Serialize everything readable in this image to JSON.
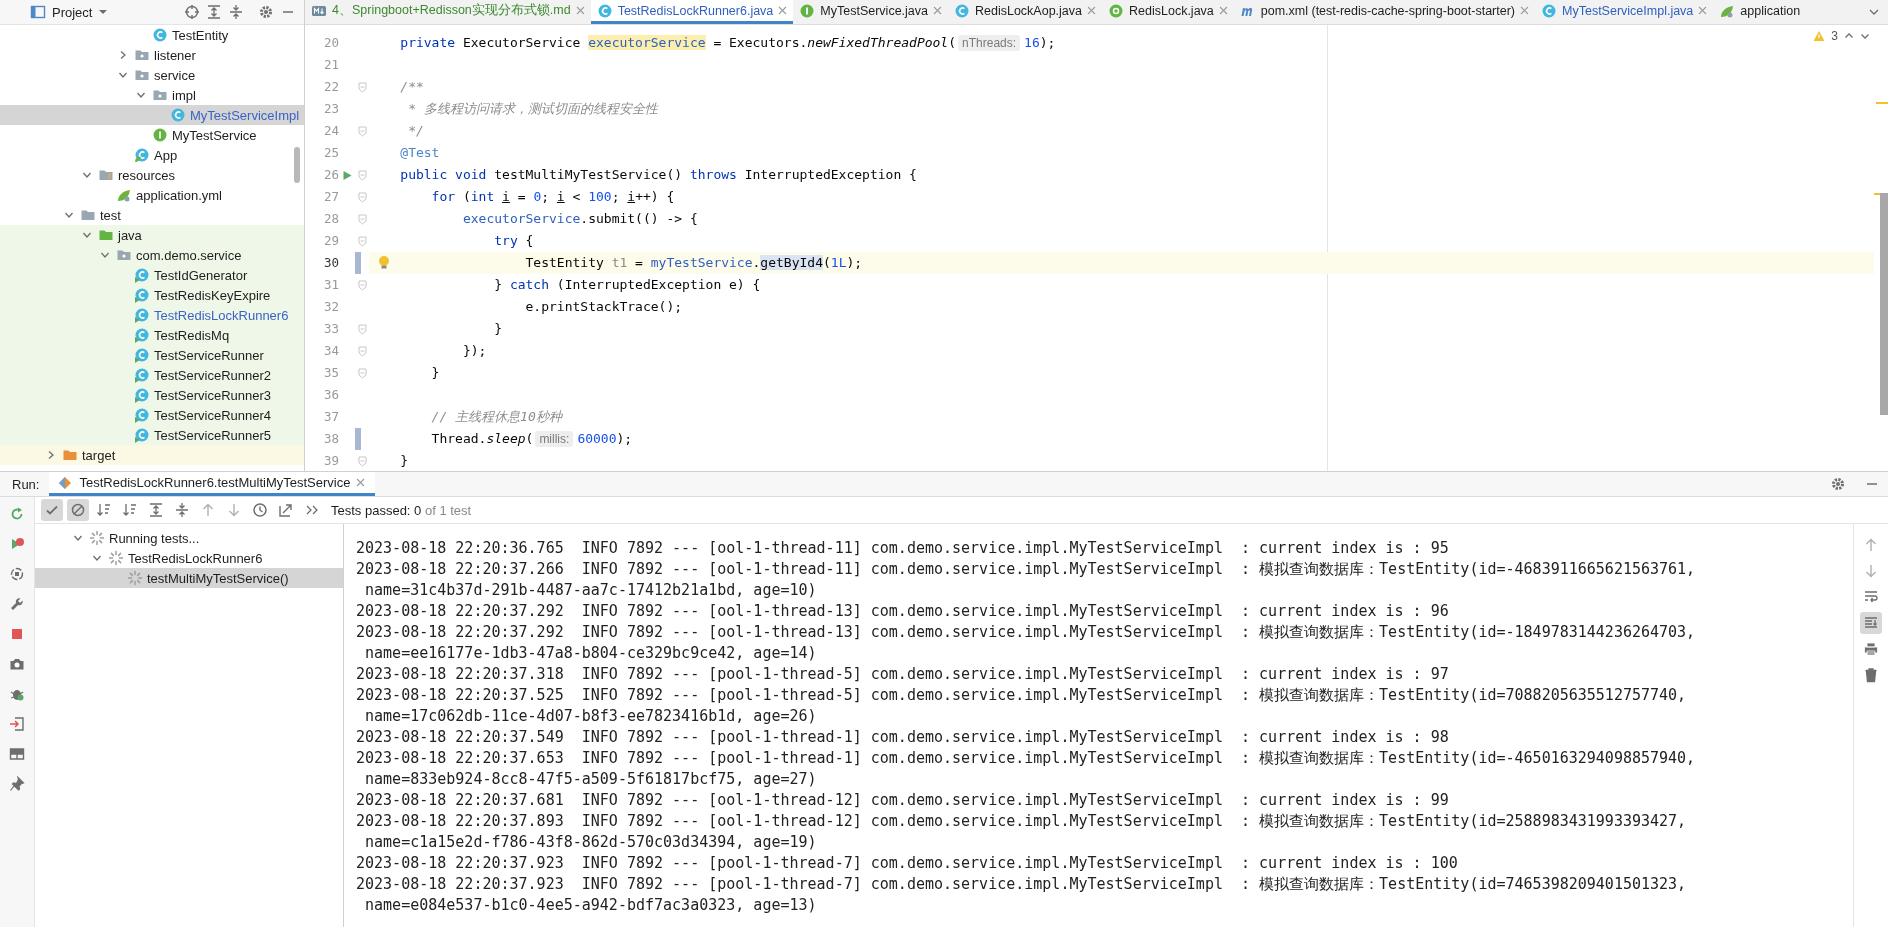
{
  "project_panel": {
    "title": "Project",
    "tree": [
      {
        "children": [
          {
            "children": [
              {
                "children": [
                  {
                    "children": [
                      {
                        "children": [
                          {
                            "label": "TestEntity",
                            "kind": "class",
                            "selected": false,
                            "modified": false,
                            "test_scope": false,
                            "excluded": false
                          }
                        ]
                      },
                      {
                        "label": "listener",
                        "kind": "package",
                        "expanded": false,
                        "selected": false,
                        "modified": false,
                        "test_scope": false,
                        "excluded": false
                      },
                      {
                        "label": "service",
                        "kind": "package",
                        "expanded": true,
                        "selected": false,
                        "modified": false,
                        "test_scope": false,
                        "excluded": false,
                        "children": [
                          {
                            "label": "impl",
                            "kind": "package",
                            "expanded": true,
                            "selected": false,
                            "modified": false,
                            "test_scope": false,
                            "excluded": false,
                            "children": [
                              {
                                "label": "MyTestServiceImpl",
                                "kind": "class",
                                "selected": true,
                                "modified": true,
                                "test_scope": false,
                                "excluded": false
                              }
                            ]
                          },
                          {
                            "label": "MyTestService",
                            "kind": "interface",
                            "selected": false,
                            "modified": false,
                            "test_scope": false,
                            "excluded": false
                          }
                        ]
                      },
                      {
                        "label": "App",
                        "kind": "boot",
                        "selected": false,
                        "modified": false,
                        "test_scope": false,
                        "excluded": false
                      }
                    ]
                  }
                ]
              },
              {
                "label": "resources",
                "kind": "resources",
                "expanded": true,
                "selected": false,
                "modified": false,
                "test_scope": false,
                "excluded": false,
                "children": [
                  {
                    "label": "application.yml",
                    "kind": "yml",
                    "selected": false,
                    "modified": false,
                    "test_scope": false,
                    "excluded": false
                  }
                ]
              }
            ]
          },
          {
            "label": "test",
            "kind": "folder",
            "expanded": true,
            "selected": false,
            "modified": false,
            "test_scope": false,
            "excluded": false,
            "children": [
              {
                "label": "java",
                "kind": "test-source",
                "expanded": true,
                "selected": false,
                "modified": false,
                "test_scope": true,
                "excluded": false,
                "children": [
                  {
                    "label": "com.demo.service",
                    "kind": "package",
                    "expanded": true,
                    "selected": false,
                    "modified": false,
                    "test_scope": true,
                    "excluded": false,
                    "children": [
                      {
                        "label": "TestIdGenerator",
                        "kind": "test-class",
                        "selected": false,
                        "modified": false,
                        "test_scope": true,
                        "excluded": false
                      },
                      {
                        "label": "TestRedisKeyExpire",
                        "kind": "test-class",
                        "selected": false,
                        "modified": false,
                        "test_scope": true,
                        "excluded": false
                      },
                      {
                        "label": "TestRedisLockRunner6",
                        "kind": "test-class",
                        "selected": false,
                        "modified": true,
                        "test_scope": true,
                        "excluded": false
                      },
                      {
                        "label": "TestRedisMq",
                        "kind": "test-class",
                        "selected": false,
                        "modified": false,
                        "test_scope": true,
                        "excluded": false
                      },
                      {
                        "label": "TestServiceRunner",
                        "kind": "test-class",
                        "selected": false,
                        "modified": false,
                        "test_scope": true,
                        "excluded": false
                      },
                      {
                        "label": "TestServiceRunner2",
                        "kind": "test-class",
                        "selected": false,
                        "modified": false,
                        "test_scope": true,
                        "excluded": false
                      },
                      {
                        "label": "TestServiceRunner3",
                        "kind": "test-class",
                        "selected": false,
                        "modified": false,
                        "test_scope": true,
                        "excluded": false
                      },
                      {
                        "label": "TestServiceRunner4",
                        "kind": "test-class",
                        "selected": false,
                        "modified": false,
                        "test_scope": true,
                        "excluded": false
                      },
                      {
                        "label": "TestServiceRunner5",
                        "kind": "test-class",
                        "selected": false,
                        "modified": false,
                        "test_scope": true,
                        "excluded": false
                      }
                    ]
                  }
                ]
              }
            ]
          }
        ]
      },
      {
        "label": "target",
        "kind": "excluded",
        "expanded": false,
        "selected": false,
        "modified": false,
        "test_scope": false,
        "excluded": true
      }
    ]
  },
  "editor_tabs": [
    {
      "label": "4、Springboot+Redisson实现分布式锁.md",
      "kind": "md",
      "color": "#3c8a2e",
      "selected": false,
      "closable": true
    },
    {
      "label": "TestRedisLockRunner6.java",
      "kind": "class",
      "color": "#2f5fbf",
      "selected": true,
      "closable": true
    },
    {
      "label": "MyTestService.java",
      "kind": "interface",
      "color": "#1e1e1e",
      "selected": false,
      "closable": true
    },
    {
      "label": "RedisLockAop.java",
      "kind": "class",
      "color": "#1e1e1e",
      "selected": false,
      "closable": true
    },
    {
      "label": "RedisLock.java",
      "kind": "annotation",
      "color": "#1e1e1e",
      "selected": false,
      "closable": true
    },
    {
      "label": "pom.xml (test-redis-cache-spring-boot-starter)",
      "kind": "maven",
      "color": "#1e1e1e",
      "selected": false,
      "closable": true
    },
    {
      "label": "MyTestServiceImpl.java",
      "kind": "class",
      "color": "#2f5fbf",
      "selected": false,
      "closable": true
    },
    {
      "label": "application",
      "kind": "yml",
      "color": "#1e1e1e",
      "selected": false,
      "closable": false
    }
  ],
  "editor": {
    "warnings": "3",
    "lines": [
      {
        "num": "20",
        "runnable": false,
        "intention": false,
        "fold": false,
        "changed": false,
        "current": false,
        "tokens": [
          {
            "kind": "kw",
            "text": "    private"
          },
          {
            "kind": "plain",
            "text": " ExecutorService "
          },
          {
            "kind": "decl",
            "text": "executorService"
          },
          {
            "kind": "plain",
            "text": " = Executors."
          },
          {
            "kind": "italic",
            "text": "newFixedThreadPool"
          },
          {
            "kind": "plain",
            "text": "("
          },
          {
            "kind": "hint",
            "text": "nThreads:"
          },
          {
            "kind": "num",
            "text": "16"
          },
          {
            "kind": "plain",
            "text": ");"
          }
        ]
      },
      {
        "num": "21",
        "runnable": false,
        "intention": false,
        "fold": false,
        "changed": false,
        "current": false
      },
      {
        "num": "22",
        "runnable": false,
        "intention": false,
        "fold": true,
        "changed": false,
        "current": false,
        "tokens": [
          {
            "kind": "comment",
            "text": "    /**"
          }
        ]
      },
      {
        "num": "23",
        "runnable": false,
        "intention": false,
        "fold": false,
        "changed": false,
        "current": false,
        "tokens": [
          {
            "kind": "comment",
            "text": "     * 多线程访问请求，测试切面的线程安全性"
          }
        ]
      },
      {
        "num": "24",
        "runnable": false,
        "intention": false,
        "fold": true,
        "changed": false,
        "current": false,
        "tokens": [
          {
            "kind": "comment",
            "text": "     */"
          }
        ]
      },
      {
        "num": "25",
        "runnable": false,
        "intention": false,
        "fold": false,
        "changed": false,
        "current": false,
        "tokens": [
          {
            "kind": "annotation",
            "text": "    @Test"
          }
        ]
      },
      {
        "num": "26",
        "runnable": true,
        "intention": false,
        "fold": true,
        "changed": false,
        "current": false,
        "tokens": [
          {
            "kind": "kw",
            "text": "    public void"
          },
          {
            "kind": "plain",
            "text": " testMultiMyTestService() "
          },
          {
            "kind": "kw",
            "text": "throws"
          },
          {
            "kind": "plain",
            "text": " InterruptedException {"
          }
        ]
      },
      {
        "num": "27",
        "runnable": false,
        "intention": false,
        "fold": true,
        "changed": false,
        "current": false,
        "tokens": [
          {
            "kind": "kw",
            "text": "        for"
          },
          {
            "kind": "plain",
            "text": " ("
          },
          {
            "kind": "kw",
            "text": "int "
          },
          {
            "kind": "var",
            "text": "i"
          },
          {
            "kind": "plain",
            "text": " = "
          },
          {
            "kind": "num",
            "text": "0"
          },
          {
            "kind": "plain",
            "text": "; "
          },
          {
            "kind": "var",
            "text": "i"
          },
          {
            "kind": "plain",
            "text": " < "
          },
          {
            "kind": "num",
            "text": "100"
          },
          {
            "kind": "plain",
            "text": "; "
          },
          {
            "kind": "var",
            "text": "i"
          },
          {
            "kind": "plain",
            "text": "++) {"
          }
        ]
      },
      {
        "num": "28",
        "runnable": false,
        "intention": false,
        "fold": true,
        "changed": false,
        "current": false,
        "tokens": [
          {
            "kind": "field",
            "text": "            executorService"
          },
          {
            "kind": "plain",
            "text": ".submit(() -> {"
          }
        ]
      },
      {
        "num": "29",
        "runnable": false,
        "intention": false,
        "fold": true,
        "changed": false,
        "current": false,
        "tokens": [
          {
            "kind": "kw",
            "text": "                try"
          },
          {
            "kind": "plain",
            "text": " {"
          }
        ]
      },
      {
        "num": "30",
        "runnable": false,
        "intention": true,
        "fold": false,
        "changed": true,
        "current": true,
        "tokens": [
          {
            "kind": "plain",
            "text": "                    TestEntity "
          },
          {
            "kind": "unused",
            "text": "t1"
          },
          {
            "kind": "plain",
            "text": " = "
          },
          {
            "kind": "field",
            "text": "myTestService"
          },
          {
            "kind": "plain",
            "text": "."
          },
          {
            "kind": "usage",
            "text": "getById4"
          },
          {
            "kind": "plain",
            "text": "("
          },
          {
            "kind": "num",
            "text": "1L"
          },
          {
            "kind": "plain",
            "text": ");"
          }
        ]
      },
      {
        "num": "31",
        "runnable": false,
        "intention": false,
        "fold": true,
        "changed": false,
        "current": false,
        "tokens": [
          {
            "kind": "plain",
            "text": "                } "
          },
          {
            "kind": "kw",
            "text": "catch"
          },
          {
            "kind": "plain",
            "text": " (InterruptedException e) {"
          }
        ]
      },
      {
        "num": "32",
        "runnable": false,
        "intention": false,
        "fold": false,
        "changed": false,
        "current": false,
        "tokens": [
          {
            "kind": "plain",
            "text": "                    e.printStackTrace();"
          }
        ]
      },
      {
        "num": "33",
        "runnable": false,
        "intention": false,
        "fold": true,
        "changed": false,
        "current": false,
        "tokens": [
          {
            "kind": "plain",
            "text": "                }"
          }
        ]
      },
      {
        "num": "34",
        "runnable": false,
        "intention": false,
        "fold": true,
        "changed": false,
        "current": false,
        "tokens": [
          {
            "kind": "plain",
            "text": "            });"
          }
        ]
      },
      {
        "num": "35",
        "runnable": false,
        "intention": false,
        "fold": true,
        "changed": false,
        "current": false,
        "tokens": [
          {
            "kind": "plain",
            "text": "        }"
          }
        ]
      },
      {
        "num": "36",
        "runnable": false,
        "intention": false,
        "fold": false,
        "changed": false,
        "current": false
      },
      {
        "num": "37",
        "runnable": false,
        "intention": false,
        "fold": false,
        "changed": false,
        "current": false,
        "tokens": [
          {
            "kind": "comment",
            "text": "        // 主线程休息10秒种"
          }
        ]
      },
      {
        "num": "38",
        "runnable": false,
        "intention": false,
        "fold": false,
        "changed": true,
        "current": false,
        "tokens": [
          {
            "kind": "plain",
            "text": "        Thread."
          },
          {
            "kind": "italic",
            "text": "sleep"
          },
          {
            "kind": "plain",
            "text": "("
          },
          {
            "kind": "hint",
            "text": "millis:"
          },
          {
            "kind": "num",
            "text": "60000"
          },
          {
            "kind": "plain",
            "text": ");"
          }
        ]
      },
      {
        "num": "39",
        "runnable": false,
        "intention": false,
        "fold": true,
        "changed": false,
        "current": false,
        "tokens": [
          {
            "kind": "plain",
            "text": "    }"
          }
        ]
      }
    ]
  },
  "run_panel": {
    "label": "Run:",
    "tab": "TestRedisLockRunner6.testMultiMyTestService",
    "side_tools": [
      {
        "kind": "rerun"
      },
      {
        "kind": "rerun-failed"
      },
      {
        "kind": "toggle-auto"
      },
      {
        "kind": "wrench"
      },
      {
        "kind": "stop"
      },
      {
        "kind": "camera"
      },
      {
        "kind": "bug"
      },
      {
        "kind": "exit"
      },
      {
        "kind": "layout"
      },
      {
        "kind": "pin"
      }
    ],
    "toolbar": [
      {
        "kind": "check",
        "pressed": true
      },
      {
        "kind": "cancel",
        "pressed": true
      },
      {
        "kind": "sort",
        "pressed": false
      },
      {
        "kind": "sort",
        "pressed": false
      },
      {
        "kind": "expand",
        "pressed": false
      },
      {
        "kind": "collapse",
        "pressed": false
      },
      {
        "kind": "up",
        "pressed": false
      },
      {
        "kind": "down",
        "pressed": false
      },
      {
        "kind": "history",
        "pressed": false
      },
      {
        "kind": "export",
        "pressed": false
      },
      {
        "kind": "more",
        "pressed": false
      }
    ],
    "status": {
      "passed": "Tests passed: 0",
      "total": "of 1 test"
    },
    "test_tree": [
      {
        "label": "Running tests...",
        "expanded": true,
        "selected": false,
        "children": [
          {
            "label": "TestRedisLockRunner6",
            "expanded": true,
            "selected": false,
            "children": [
              {
                "label": "testMultiMyTestService()",
                "selected": true
              }
            ]
          }
        ]
      }
    ],
    "console_tools": [
      {
        "kind": "up",
        "pressed": false
      },
      {
        "kind": "down",
        "pressed": false
      },
      {
        "kind": "wrap",
        "pressed": false
      },
      {
        "kind": "scroll-end",
        "pressed": true
      },
      {
        "kind": "print",
        "pressed": false
      },
      {
        "kind": "trash",
        "pressed": false
      }
    ],
    "console_lines": [
      "2023-08-18 22:20:36.765  INFO 7892 --- [ool-1-thread-11] com.demo.service.impl.MyTestServiceImpl  : current index is : 95",
      "2023-08-18 22:20:37.266  INFO 7892 --- [ool-1-thread-11] com.demo.service.impl.MyTestServiceImpl  : 模拟查询数据库：TestEntity(id=-4683911665621563761,",
      " name=31c4b37d-291b-4487-aa7c-17412b21a1bd, age=10)",
      "2023-08-18 22:20:37.292  INFO 7892 --- [ool-1-thread-13] com.demo.service.impl.MyTestServiceImpl  : current index is : 96",
      "2023-08-18 22:20:37.292  INFO 7892 --- [ool-1-thread-13] com.demo.service.impl.MyTestServiceImpl  : 模拟查询数据库：TestEntity(id=-1849783144236264703,",
      " name=ee16177e-1db3-47a8-b804-ce329bc9ce42, age=14)",
      "2023-08-18 22:20:37.318  INFO 7892 --- [pool-1-thread-5] com.demo.service.impl.MyTestServiceImpl  : current index is : 97",
      "2023-08-18 22:20:37.525  INFO 7892 --- [pool-1-thread-5] com.demo.service.impl.MyTestServiceImpl  : 模拟查询数据库：TestEntity(id=7088205635512757740,",
      " name=17c062db-11ce-4d07-b8f3-ee7823416b1d, age=26)",
      "2023-08-18 22:20:37.549  INFO 7892 --- [pool-1-thread-1] com.demo.service.impl.MyTestServiceImpl  : current index is : 98",
      "2023-08-18 22:20:37.653  INFO 7892 --- [pool-1-thread-1] com.demo.service.impl.MyTestServiceImpl  : 模拟查询数据库：TestEntity(id=-4650163294098857940,",
      " name=833eb924-8cc8-47f5-a509-5f61817bcf75, age=27)",
      "2023-08-18 22:20:37.681  INFO 7892 --- [ool-1-thread-12] com.demo.service.impl.MyTestServiceImpl  : current index is : 99",
      "2023-08-18 22:20:37.893  INFO 7892 --- [ool-1-thread-12] com.demo.service.impl.MyTestServiceImpl  : 模拟查询数据库：TestEntity(id=2588983431993393427,",
      " name=c1a15e2d-f786-43f8-862d-570c03d34394, age=19)",
      "2023-08-18 22:20:37.923  INFO 7892 --- [pool-1-thread-7] com.demo.service.impl.MyTestServiceImpl  : current index is : 100",
      "2023-08-18 22:20:37.923  INFO 7892 --- [pool-1-thread-7] com.demo.service.impl.MyTestServiceImpl  : 模拟查询数据库：TestEntity(id=7465398209401501323,",
      " name=e084e537-b1c0-4ee5-a942-bdf7ac3a0323, age=13)"
    ]
  }
}
